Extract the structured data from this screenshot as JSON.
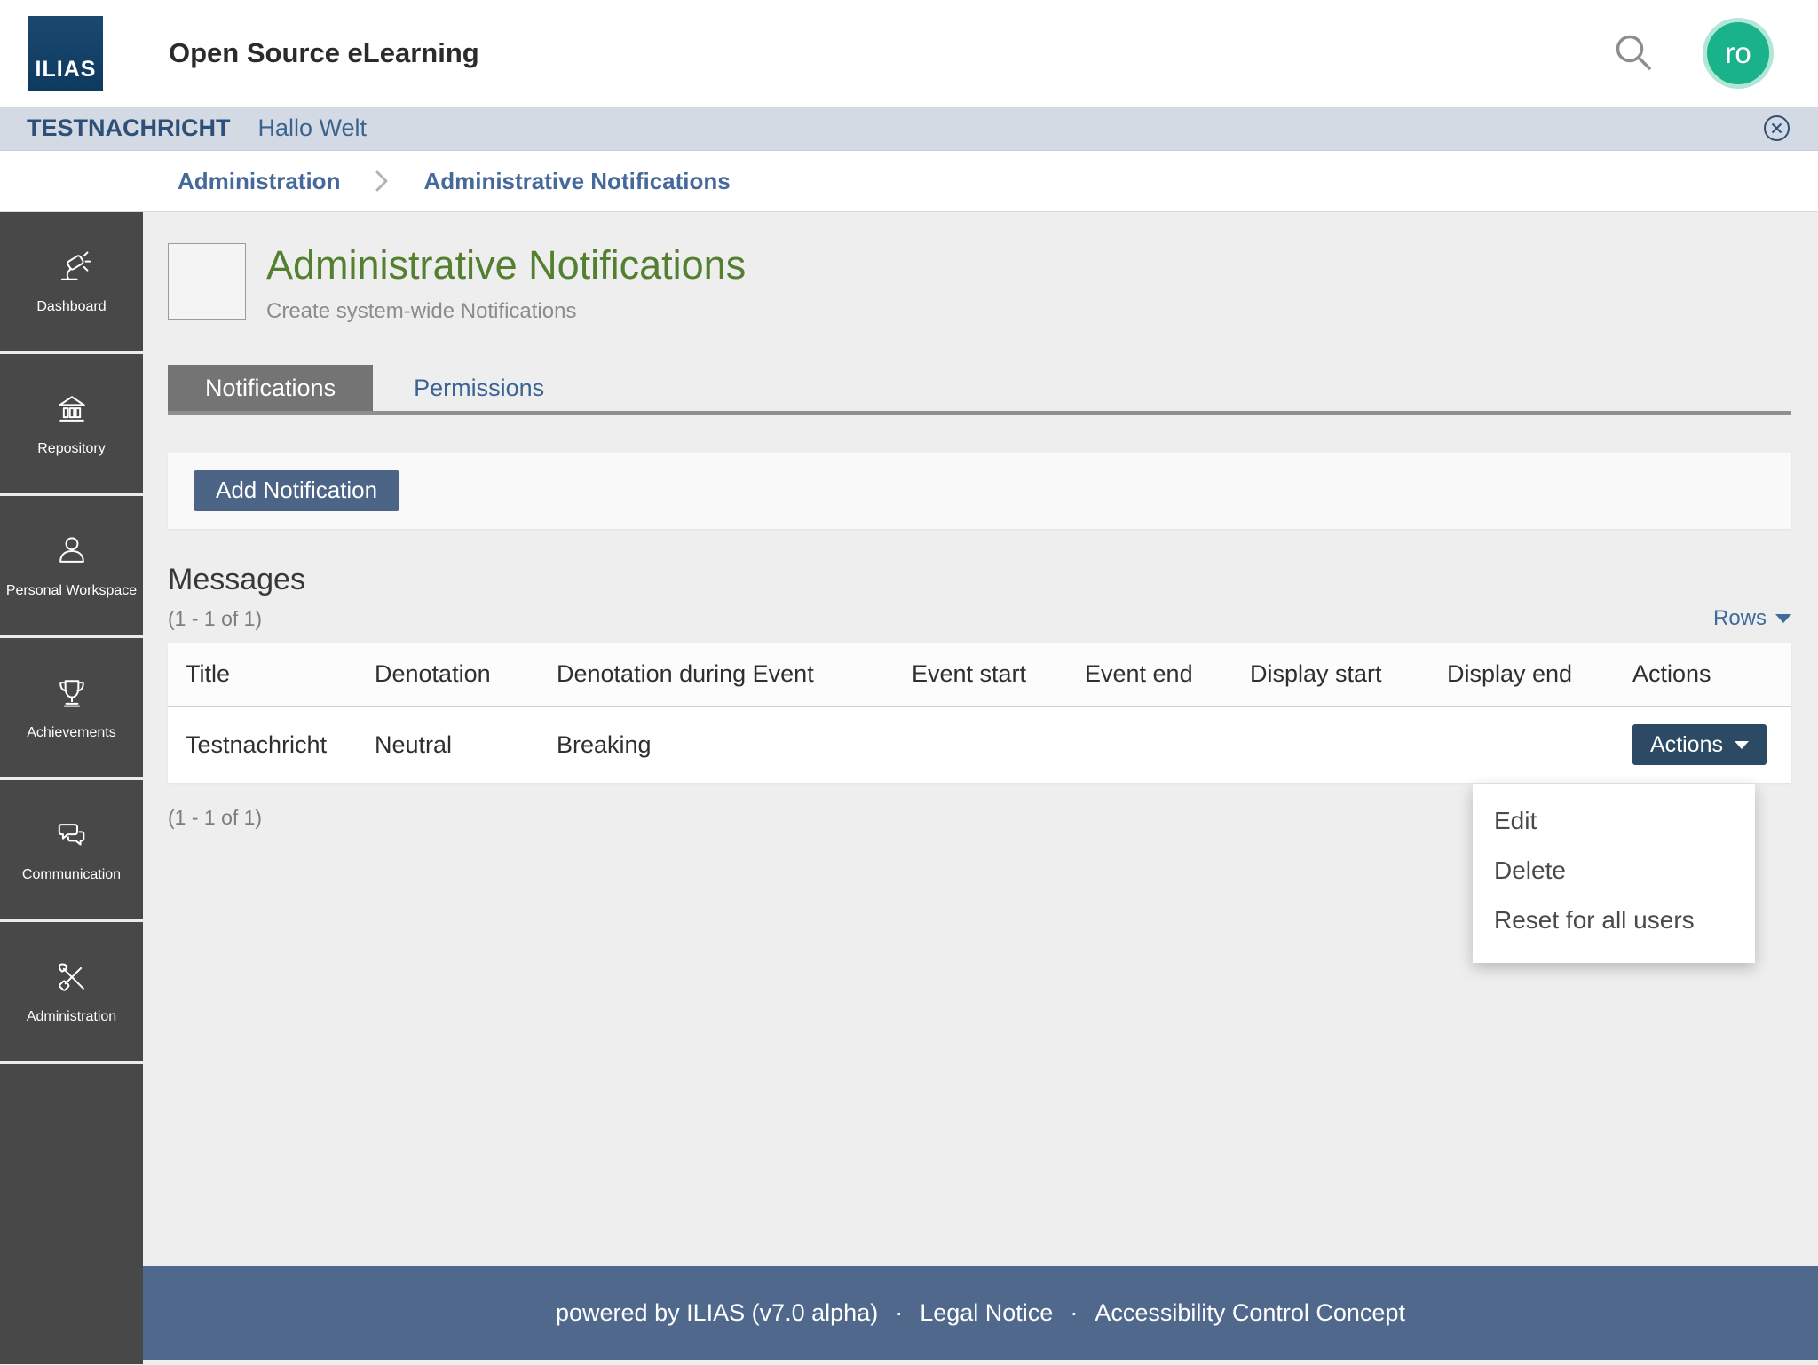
{
  "header": {
    "logo_text": "ILIAS",
    "title": "Open Source eLearning",
    "avatar_initials": "ro",
    "icons": [
      "search-icon",
      "avatar"
    ]
  },
  "notification_bar": {
    "label": "TESTNACHRICHT",
    "message": "Hallo Welt",
    "close_icon": "close-icon"
  },
  "breadcrumb": {
    "items": [
      {
        "label": "Administration"
      },
      {
        "label": "Administrative Notifications"
      }
    ]
  },
  "sidebar": {
    "items": [
      {
        "label": "Dashboard",
        "icon": "lamp-icon"
      },
      {
        "label": "Repository",
        "icon": "bank-icon"
      },
      {
        "label": "Personal Workspace",
        "icon": "person-icon"
      },
      {
        "label": "Achievements",
        "icon": "trophy-icon"
      },
      {
        "label": "Communication",
        "icon": "chat-bubbles-icon"
      },
      {
        "label": "Administration",
        "icon": "tools-icon"
      }
    ]
  },
  "page": {
    "title": "Administrative Notifications",
    "subtitle": "Create system-wide Notifications"
  },
  "tabs": [
    {
      "label": "Notifications",
      "active": true
    },
    {
      "label": "Permissions",
      "active": false
    }
  ],
  "toolbar": {
    "add_button": "Add Notification"
  },
  "messages": {
    "heading": "Messages",
    "count_top": "(1 - 1 of 1)",
    "count_bottom": "(1 - 1 of 1)",
    "rows_label": "Rows"
  },
  "table": {
    "columns": [
      "Title",
      "Denotation",
      "Denotation during Event",
      "Event start",
      "Event end",
      "Display start",
      "Display end",
      "Actions"
    ],
    "rows": [
      {
        "title": "Testnachricht",
        "denotation": "Neutral",
        "denotation_during_event": "Breaking",
        "event_start": "",
        "event_end": "",
        "display_start": "",
        "display_end": "",
        "actions_label": "Actions"
      }
    ]
  },
  "actions_menu": {
    "items": [
      "Edit",
      "Delete",
      "Reset for all users"
    ]
  },
  "footer": {
    "powered_by": "powered by ILIAS (v7.0 alpha)",
    "separator": "·",
    "links": [
      "Legal Notice",
      "Accessibility Control Concept"
    ]
  },
  "colors": {
    "accent_green": "#537f31",
    "primary_button": "#4c6586",
    "actions_button": "#2c4a63",
    "footer_bg": "#4f688c",
    "sidebar_bg": "#484848",
    "notification_bar_bg": "#d4dae3",
    "link_blue": "#3c6493",
    "avatar_bg": "#19b28a"
  }
}
